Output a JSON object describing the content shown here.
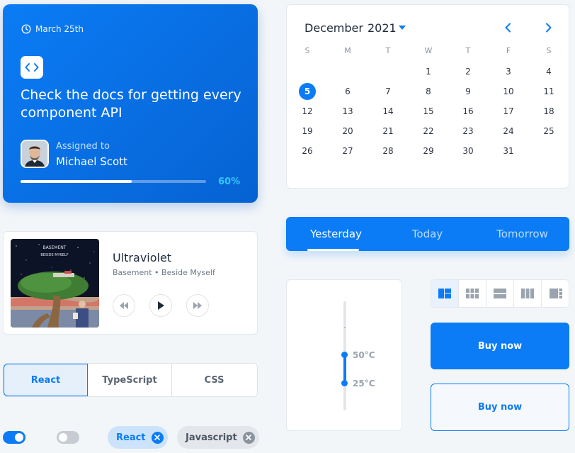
{
  "task": {
    "date": "March 25th",
    "title": "Check the docs for getting every component API",
    "assigned_label": "Assigned to",
    "assignee": "Michael Scott",
    "progress": 0.6,
    "progress_label": "60%",
    "icons": {
      "clock": "clock-icon",
      "code": "code-icon"
    },
    "accent": "#0b7cf5"
  },
  "calendar": {
    "month": "December",
    "year": "2021",
    "weekdays": [
      "S",
      "M",
      "T",
      "W",
      "T",
      "F",
      "S"
    ],
    "first_weekday_index": 3,
    "days_in_month": 31,
    "selected_day": 5
  },
  "player": {
    "song": "Ultraviolet",
    "subtitle": "Basement • Beside Myself",
    "album_text_1": "BASEMENT",
    "album_text_2": "BESIDE MYSELF"
  },
  "tabs": {
    "items": [
      "Yesterday",
      "Today",
      "Tomorrow"
    ],
    "active": 0
  },
  "languages": {
    "items": [
      "React",
      "TypeScript",
      "CSS"
    ],
    "active": 0
  },
  "toggles": [
    {
      "on": true
    },
    {
      "on": false
    }
  ],
  "chips": [
    {
      "label": "React",
      "selected": true
    },
    {
      "label": "Javascript",
      "selected": false
    }
  ],
  "slider": {
    "min_label": "25°C",
    "max_label": "50°C"
  },
  "view_switcher": {
    "icons": [
      "dashboard-icon",
      "grid-icon",
      "rows-icon",
      "columns-icon",
      "sidebar-layout-icon"
    ],
    "active": 0
  },
  "buttons": {
    "buy_primary": "Buy now",
    "buy_outline": "Buy now"
  },
  "colors": {
    "primary": "#0b7cf5",
    "chip_selected_bg": "#cce3fb",
    "chip_bg": "#e3e6ea"
  }
}
